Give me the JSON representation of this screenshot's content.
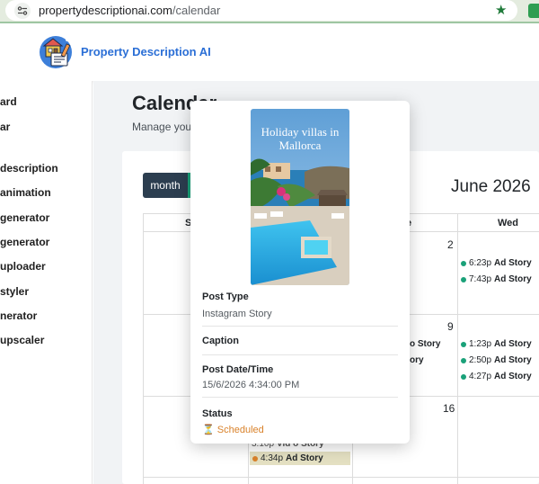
{
  "browser": {
    "url_domain": "propertydescriptionai.com",
    "url_path": "/calendar"
  },
  "app": {
    "brand": "Property Description AI"
  },
  "sidebar": {
    "items": [
      "ard",
      "ar",
      "description",
      "animation",
      "generator",
      "generator",
      "uploader",
      "styler",
      "nerator",
      "upscaler"
    ]
  },
  "page": {
    "title": "Calendar",
    "subtitle": "Manage your"
  },
  "calendar": {
    "view_button": "month",
    "month_title": "June 2026",
    "headers": [
      "S",
      "e",
      "Wed"
    ],
    "days": [
      "2",
      "9",
      "16"
    ],
    "wed_week1": [
      {
        "time": "6:23p",
        "name": "Ad Story"
      },
      {
        "time": "7:43p",
        "name": "Ad Story"
      }
    ],
    "wed_week2": [
      {
        "time": "1:23p",
        "name": "Ad Story"
      },
      {
        "time": "2:50p",
        "name": "Ad Story"
      },
      {
        "time": "4:27p",
        "name": "Ad Story"
      }
    ],
    "tue_week2_partial": [
      "o Story",
      "ory"
    ],
    "week3_partial": {
      "time": "3:10p",
      "name": "Vid   o Story"
    },
    "week3_highlight": {
      "time": "4:34p",
      "name": "Ad Story"
    }
  },
  "popover": {
    "image_title": "Holiday villas in Mallorca",
    "post_type_label": "Post Type",
    "post_type_value": "Instagram Story",
    "caption_label": "Caption",
    "datetime_label": "Post Date/Time",
    "datetime_value": "15/6/2026 4:34:00 PM",
    "status_label": "Status",
    "status_value": "Scheduled",
    "status_icon": "hourglass-icon"
  },
  "colors": {
    "brand": "#2b6fd6",
    "dark_button": "#2c3e50",
    "success": "#1aa179",
    "scheduled": "#d9822b",
    "highlight": "#e4e0c2"
  }
}
